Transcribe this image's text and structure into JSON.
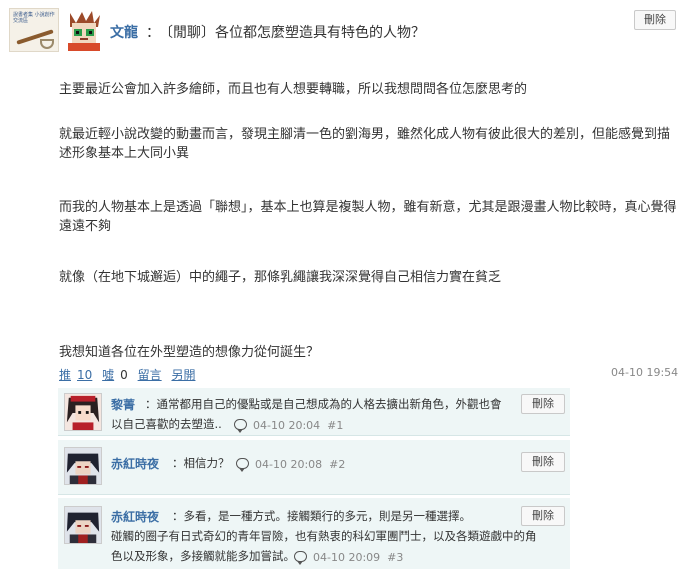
{
  "post": {
    "author": "文龍",
    "colon": "：",
    "title": "〔閒聊〕各位都怎麼塑造具有特色的人物？",
    "delete_label": "刪除",
    "board_avatar_text": "說書者集 小說創作 交流區",
    "body": [
      "主要最近公會加入許多繪師，而且也有人想要轉職，所以我想問問各位怎麼思考的",
      "就最近輕小說改變的動畫而言，發現主腳清一色的劉海男，雖然化成人物有彼此很大的差別，但能感覺到描述形象基本上大同小異",
      "而我的人物基本上是透過「聯想」，基本上也算是複製人物，雖有新意，尤其是跟漫畫人物比較時，真心覺得遠遠不夠",
      "就像（在地下城邂逅）中的繩子，那條乳繩讓我深深覺得自己相信力實在貧乏",
      "我想知道各位在外型塑造的想像力從何誕生？"
    ],
    "actions": {
      "push_label": "推",
      "push_count": "10",
      "boo_label": "噓",
      "boo_count": "0",
      "reply_label": "留言",
      "share_label": "另開"
    },
    "time": "04-10 19:54"
  },
  "comments": [
    {
      "author": "黎菁",
      "text_line1": "：通常都用自己的優點或是自己想成為的人格去擴出新角色，外觀也會",
      "text_line2": "以自己喜歡的去塑造..",
      "time": "04-10 20:04",
      "floor": "#1",
      "delete_label": "刪除"
    },
    {
      "author": "赤紅時夜",
      "text_line1": "：相信力？",
      "time": "04-10 20:08",
      "floor": "#2",
      "delete_label": "刪除"
    },
    {
      "author": "赤紅時夜",
      "text_line1": "：多看，是一種方式。接觸類行的多元，則是另一種選擇。",
      "text_line2": "碰觸的圈子有日式奇幻的青年冒險，也有熱衷的科幻軍團鬥士，以及各類遊戲中的角",
      "text_line3": "色以及形象，多接觸就能多加嘗試。",
      "time": "04-10 20:09",
      "floor": "#3",
      "delete_label": "刪除"
    }
  ],
  "colors": {
    "link": "#3b6ea5",
    "comment_bg": "#eef6f6",
    "meta": "#888888"
  }
}
